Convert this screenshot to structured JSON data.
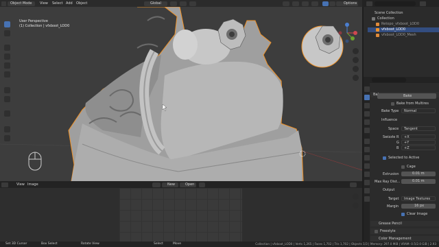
{
  "viewport": {
    "mode": "Object Mode",
    "menus": [
      "View",
      "Select",
      "Add",
      "Object"
    ],
    "transform": "Global",
    "options": "Options",
    "info_line1": "User Perspective",
    "info_line2": "(1) Collection | vfxboot_LOD0"
  },
  "image_editor": {
    "menus": [
      "View",
      "Image"
    ],
    "new_label": "New",
    "open_label": "Open"
  },
  "outliner": {
    "header": "Scene Collection",
    "items": [
      {
        "label": "Collection",
        "selected": false
      },
      {
        "label": "Retopo_vfxboot_LOD0",
        "selected": false
      },
      {
        "label": "vfxboot_LOD0",
        "selected": true
      },
      {
        "label": "vfxboot_LOD0_Mesh",
        "selected": false
      }
    ]
  },
  "properties": {
    "engine_label": "Bake",
    "bake_btn": "Bake",
    "from_multires": "Bake from Multires",
    "bake_type_label": "Bake Type",
    "bake_type_value": "Normal",
    "influence": "Influence",
    "space_label": "Space",
    "space_value": "Tangent",
    "swizzle_label": "Swizzle R",
    "swizzle_r": "+X",
    "g_label": "G",
    "swizzle_g": "+Y",
    "b_label": "B",
    "swizzle_b": "+Z",
    "selected_to_active": "Selected to Active",
    "cage": "Cage",
    "extrusion_label": "Extrusion",
    "extrusion_value": "0.01 m",
    "max_ray_label": "Max Ray Dist...",
    "max_ray_value": "0.01 m",
    "output": "Output",
    "target_label": "Target",
    "target_value": "Image Textures",
    "margin_label": "Margin",
    "margin_value": "16 px",
    "clear_image": "Clear Image",
    "grease_pencil": "Grease Pencil",
    "freestyle": "Freestyle",
    "color_management": "Color Management"
  },
  "statusbar": {
    "left": [
      "Set 3D Cursor",
      "Box Select",
      "Rotate View",
      "Select",
      "Move"
    ],
    "right": "Collection | vfxboot_LOD0 | Verts 1,265 | Faces 1,702 | Tris 1,702 | Objects 1/3 | Memory: 297.0 MiB | VRAM: 0.5/2.0 GiB | 2.93"
  },
  "colors": {
    "accent": "#4772b3",
    "selected_outline": "#f09228",
    "viewport_bg": "#3d3d3d",
    "panel_bg": "#2b2b2b"
  }
}
